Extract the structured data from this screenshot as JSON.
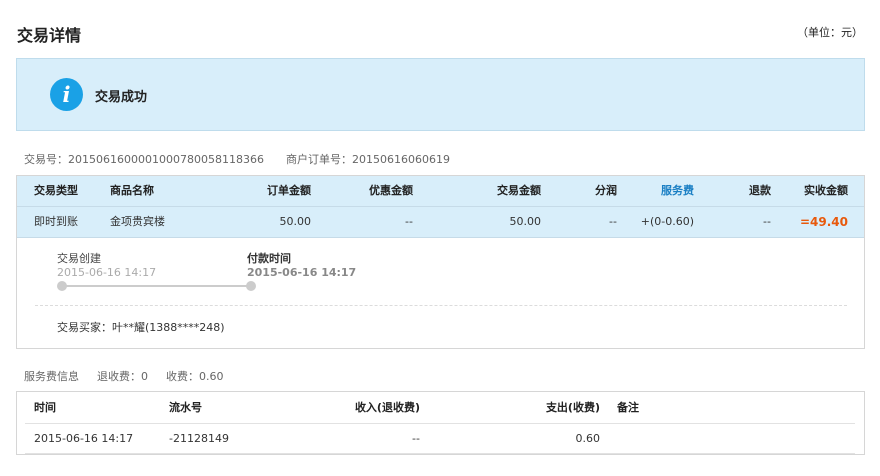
{
  "header": {
    "title": "交易详情",
    "unit": "（单位：元）"
  },
  "status": {
    "icon": "info-icon",
    "icon_glyph": "i",
    "text": "交易成功",
    "accent_color": "#1aa1e6"
  },
  "ids": {
    "trade_no": "交易号：2015061600001000780058118366",
    "merchant_order_no": "商户订单号：20150616060619"
  },
  "order_table": {
    "headers": [
      "交易类型",
      "商品名称",
      "订单金额",
      "优惠金额",
      "交易金额",
      "分润",
      "服务费",
      "退款",
      "实收金额"
    ],
    "row": [
      "即时到账",
      "金项贵宾楼",
      "50.00",
      "--",
      "50.00",
      "--",
      "+(0-0.60)",
      "--",
      "=49.40"
    ]
  },
  "timeline": {
    "steps": [
      {
        "label": "交易创建",
        "time": "2015-06-16 14:17"
      },
      {
        "label": "付款时间",
        "time": "2015-06-16 14:17"
      }
    ],
    "buyer": "交易买家：叶**耀(1388****248)"
  },
  "fee_info": {
    "label": "服务费信息",
    "refund_fee": "退收费：0",
    "charge_fee": "收费：0.60"
  },
  "fee_table": {
    "headers": [
      "时间",
      "流水号",
      "收入(退收费)",
      "支出(收费)",
      "备注"
    ],
    "row": [
      "2015-06-16 14:17",
      "-21128149",
      "--",
      "0.60",
      ""
    ]
  },
  "colors": {
    "panel_bg": "#d8eefa",
    "total_color": "#e8590c",
    "link_color": "#1a7fc4"
  }
}
